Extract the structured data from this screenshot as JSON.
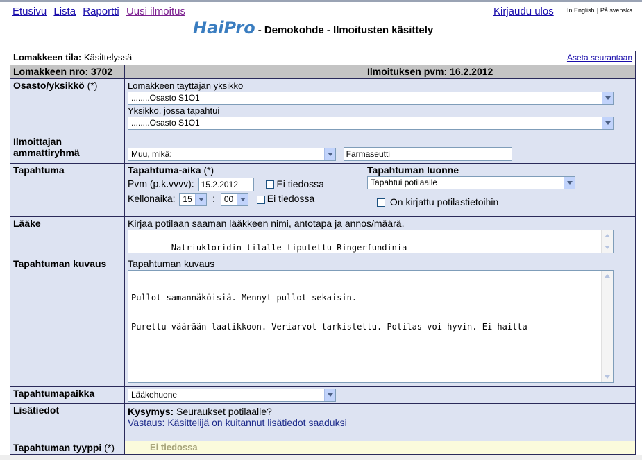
{
  "nav": {
    "items": [
      "Etusivu",
      "Lista",
      "Raportti",
      "Uusi ilmoitus"
    ],
    "logout": "Kirjaudu ulos",
    "lang_en": "In English",
    "lang_sv": "På svenska"
  },
  "header": {
    "logo": "HaiPro",
    "subtitle": "- Demokohde - Ilmoitusten käsittely"
  },
  "form": {
    "status_label": "Lomakkeen tila:",
    "status_value": "Käsittelyssä",
    "follow_link": "Aseta seurantaan",
    "form_no": "Lomakkeen nro: 3702",
    "report_date": "Ilmoituksen pvm: 16.2.2012",
    "unit": {
      "label": "Osasto/yksikkö",
      "req": "(*)",
      "filler_label": "Lomakkeen täyttäjän yksikkö",
      "filler_value": "........Osasto S1O1",
      "event_label": "Yksikkö, jossa tapahtui",
      "event_value": "........Osasto S1O1"
    },
    "profession": {
      "label": "Ilmoittajan ammattiryhmä",
      "select_value": "Muu, mikä:",
      "other_value": "Farmaseutti"
    },
    "event": {
      "label": "Tapahtuma",
      "time_label": "Tapahtuma-aika",
      "time_req": "(*)",
      "date_label": "Pvm (p.k.vvvv):",
      "date_value": "15.2.2012",
      "unknown1": "Ei tiedossa",
      "clock_label": "Kellonaika:",
      "hour": "15",
      "minute": "00",
      "unknown2": "Ei tiedossa",
      "nature_label": "Tapahtuman luonne",
      "nature_value": "Tapahtui potilaalle",
      "record_label": "On kirjattu potilastietoihin"
    },
    "drug": {
      "label": "Lääke",
      "instructions": "Kirjaa potilaan saaman lääkkeen nimi, antotapa ja annos/määrä.",
      "value": "Natriukloridin tilalle tiputettu Ringerfundinia"
    },
    "description": {
      "label": "Tapahtuman kuvaus",
      "sub_label": "Tapahtuman kuvaus",
      "line1": "Pullot samannäköisiä. Mennyt pullot sekaisin.",
      "line2": "Purettu väärään laatikkoon. Veriarvot tarkistettu. Potilas voi hyvin. Ei haitta"
    },
    "place": {
      "label": "Tapahtumapaikka",
      "value": "Lääkehuone"
    },
    "extra": {
      "label": "Lisätiedot",
      "question_label": "Kysymys:",
      "question": "Seuraukset potilaalle?",
      "answer_label": "Vastaus:",
      "answer": "Käsittelijä on kuitannut lisätiedot saaduksi"
    },
    "type": {
      "label": "Tapahtuman tyyppi",
      "req": "(*)",
      "value": "Ei tiedossa"
    }
  }
}
